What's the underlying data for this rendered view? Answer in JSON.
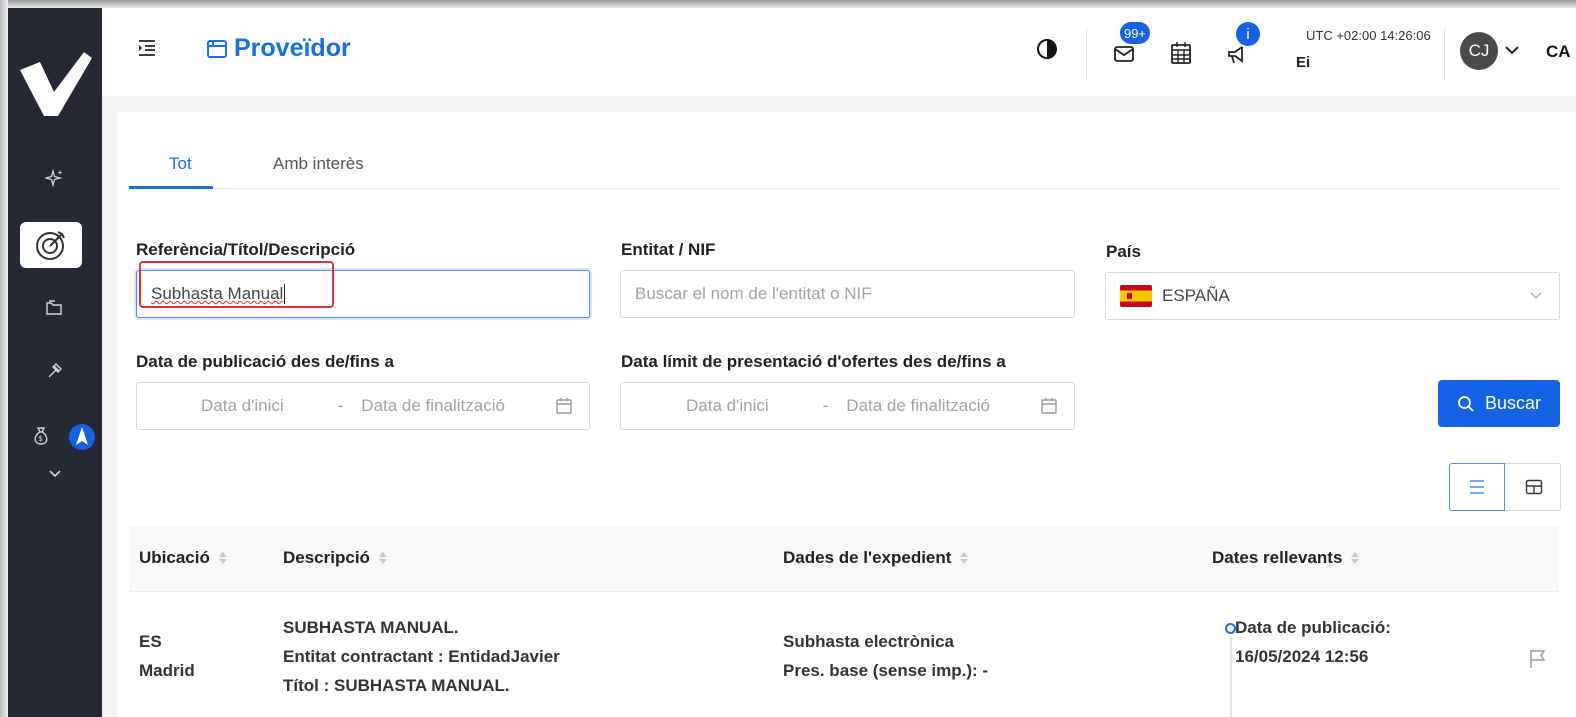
{
  "header": {
    "app_title": "Proveïdor",
    "notifications_badge": "99+",
    "info_badge": "i",
    "utc_time": "UTC +02:00 14:26:06",
    "user_short": "Ei",
    "avatar_initials": "CJ",
    "language": "CA"
  },
  "tabs": [
    {
      "label": "Tot",
      "active": true
    },
    {
      "label": "Amb interès",
      "active": false
    }
  ],
  "filters": {
    "reference_label": "Referència/Títol/Descripció",
    "reference_value": "Subhasta Manual",
    "entity_label": "Entitat / NIF",
    "entity_placeholder": "Buscar el nom de l'entitat o NIF",
    "country_label": "País",
    "country_value": "ESPAÑA",
    "pub_date_label": "Data de publicació des de/fins a",
    "deadline_label": "Data límit de presentació d'ofertes des de/fins a",
    "start_placeholder": "Data d'inici",
    "end_placeholder": "Data de finalització",
    "range_sep": "-",
    "search_button": "Buscar"
  },
  "table": {
    "columns": [
      "Ubicació",
      "Descripció",
      "Dades de l'expedient",
      "Dates rellevants"
    ],
    "rows": [
      {
        "location_country": "ES",
        "location_city": "Madrid",
        "desc_title": "SUBHASTA MANUAL.",
        "desc_entity": "Entitat contractant : EntidadJavier",
        "desc_titol": "Títol : SUBHASTA MANUAL.",
        "exp_type": "Subhasta electrònica",
        "exp_base": "Pres. base (sense imp.): -",
        "date_label": "Data de publicació:",
        "date_value": "16/05/2024 12:56"
      }
    ]
  },
  "colors": {
    "accent": "#1670e8",
    "sidebar": "#242933",
    "highlight_box": "#e03434"
  }
}
